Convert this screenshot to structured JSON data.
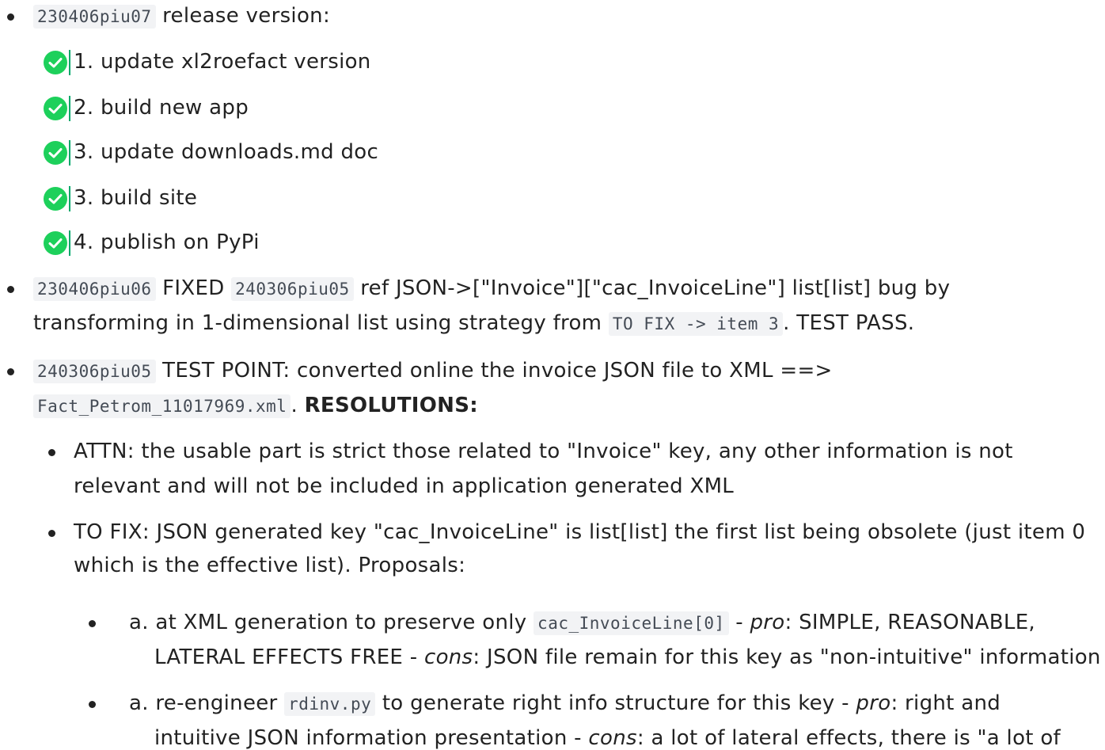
{
  "colors": {
    "check_fill": "#1dd05b",
    "check_mark": "#ffffff",
    "code_bg": "#f2f3f5"
  },
  "item1": {
    "code": "230406piu07",
    "text": " release version:",
    "tasks": [
      {
        "label": "1. update xl2roefact version",
        "icon": "check-circle-icon",
        "done": true
      },
      {
        "label": "2. build new app",
        "icon": "check-circle-icon",
        "done": true
      },
      {
        "label": "3. update downloads.md doc",
        "icon": "check-circle-icon",
        "done": true
      },
      {
        "label": "3. build site",
        "icon": "check-circle-icon",
        "done": true
      },
      {
        "label": "4. publish on PyPi",
        "icon": "check-circle-icon",
        "done": true
      }
    ]
  },
  "item2": {
    "code1": "230406piu06",
    "t1": " FIXED ",
    "code2": "240306piu05",
    "t2": " ref JSON->[\"Invoice\"][\"cac_InvoiceLine\"] list[list] bug by",
    "t3": "transforming in 1-dimensional list using strategy from ",
    "code3": "TO FIX -> item 3",
    "t4": ". TEST PASS."
  },
  "item3": {
    "code1": "240306piu05",
    "t1": " TEST POINT: converted online the invoice JSON file to XML ==>",
    "code2": "Fact_Petrom_11017969.xml",
    "t2": ". ",
    "bold": "RESOLUTIONS:",
    "attn_line1": "ATTN: the usable part is strict those related to \"Invoice\" key, any other information is not",
    "attn_line2": "relevant and will not be included in application generated XML",
    "fix_line1": "TO FIX: JSON generated key \"cac_InvoiceLine\" is list[list] the first list being obsolete (just item 0",
    "fix_line2": "which is the effective list). Proposals:",
    "pa": {
      "t1": "a. at XML generation to preserve only ",
      "code": "cac_InvoiceLine[0]",
      "t2": " - ",
      "pro": "pro",
      "t3": ": SIMPLE, REASONABLE,",
      "t4": "LATERAL EFFECTS FREE - ",
      "cons": "cons",
      "t5": ": JSON file remain for this key as \"non-intuitive\" information"
    },
    "pb": {
      "t1": "a. re-engineer ",
      "code": "rdinv.py",
      "t2": " to generate right info structure for this key - ",
      "pro": "pro",
      "t3": ": right and",
      "t4": "intuitive JSON information presentation - ",
      "cons": "cons",
      "t5": ": a lot of lateral effects, there is \"a lot of"
    }
  }
}
